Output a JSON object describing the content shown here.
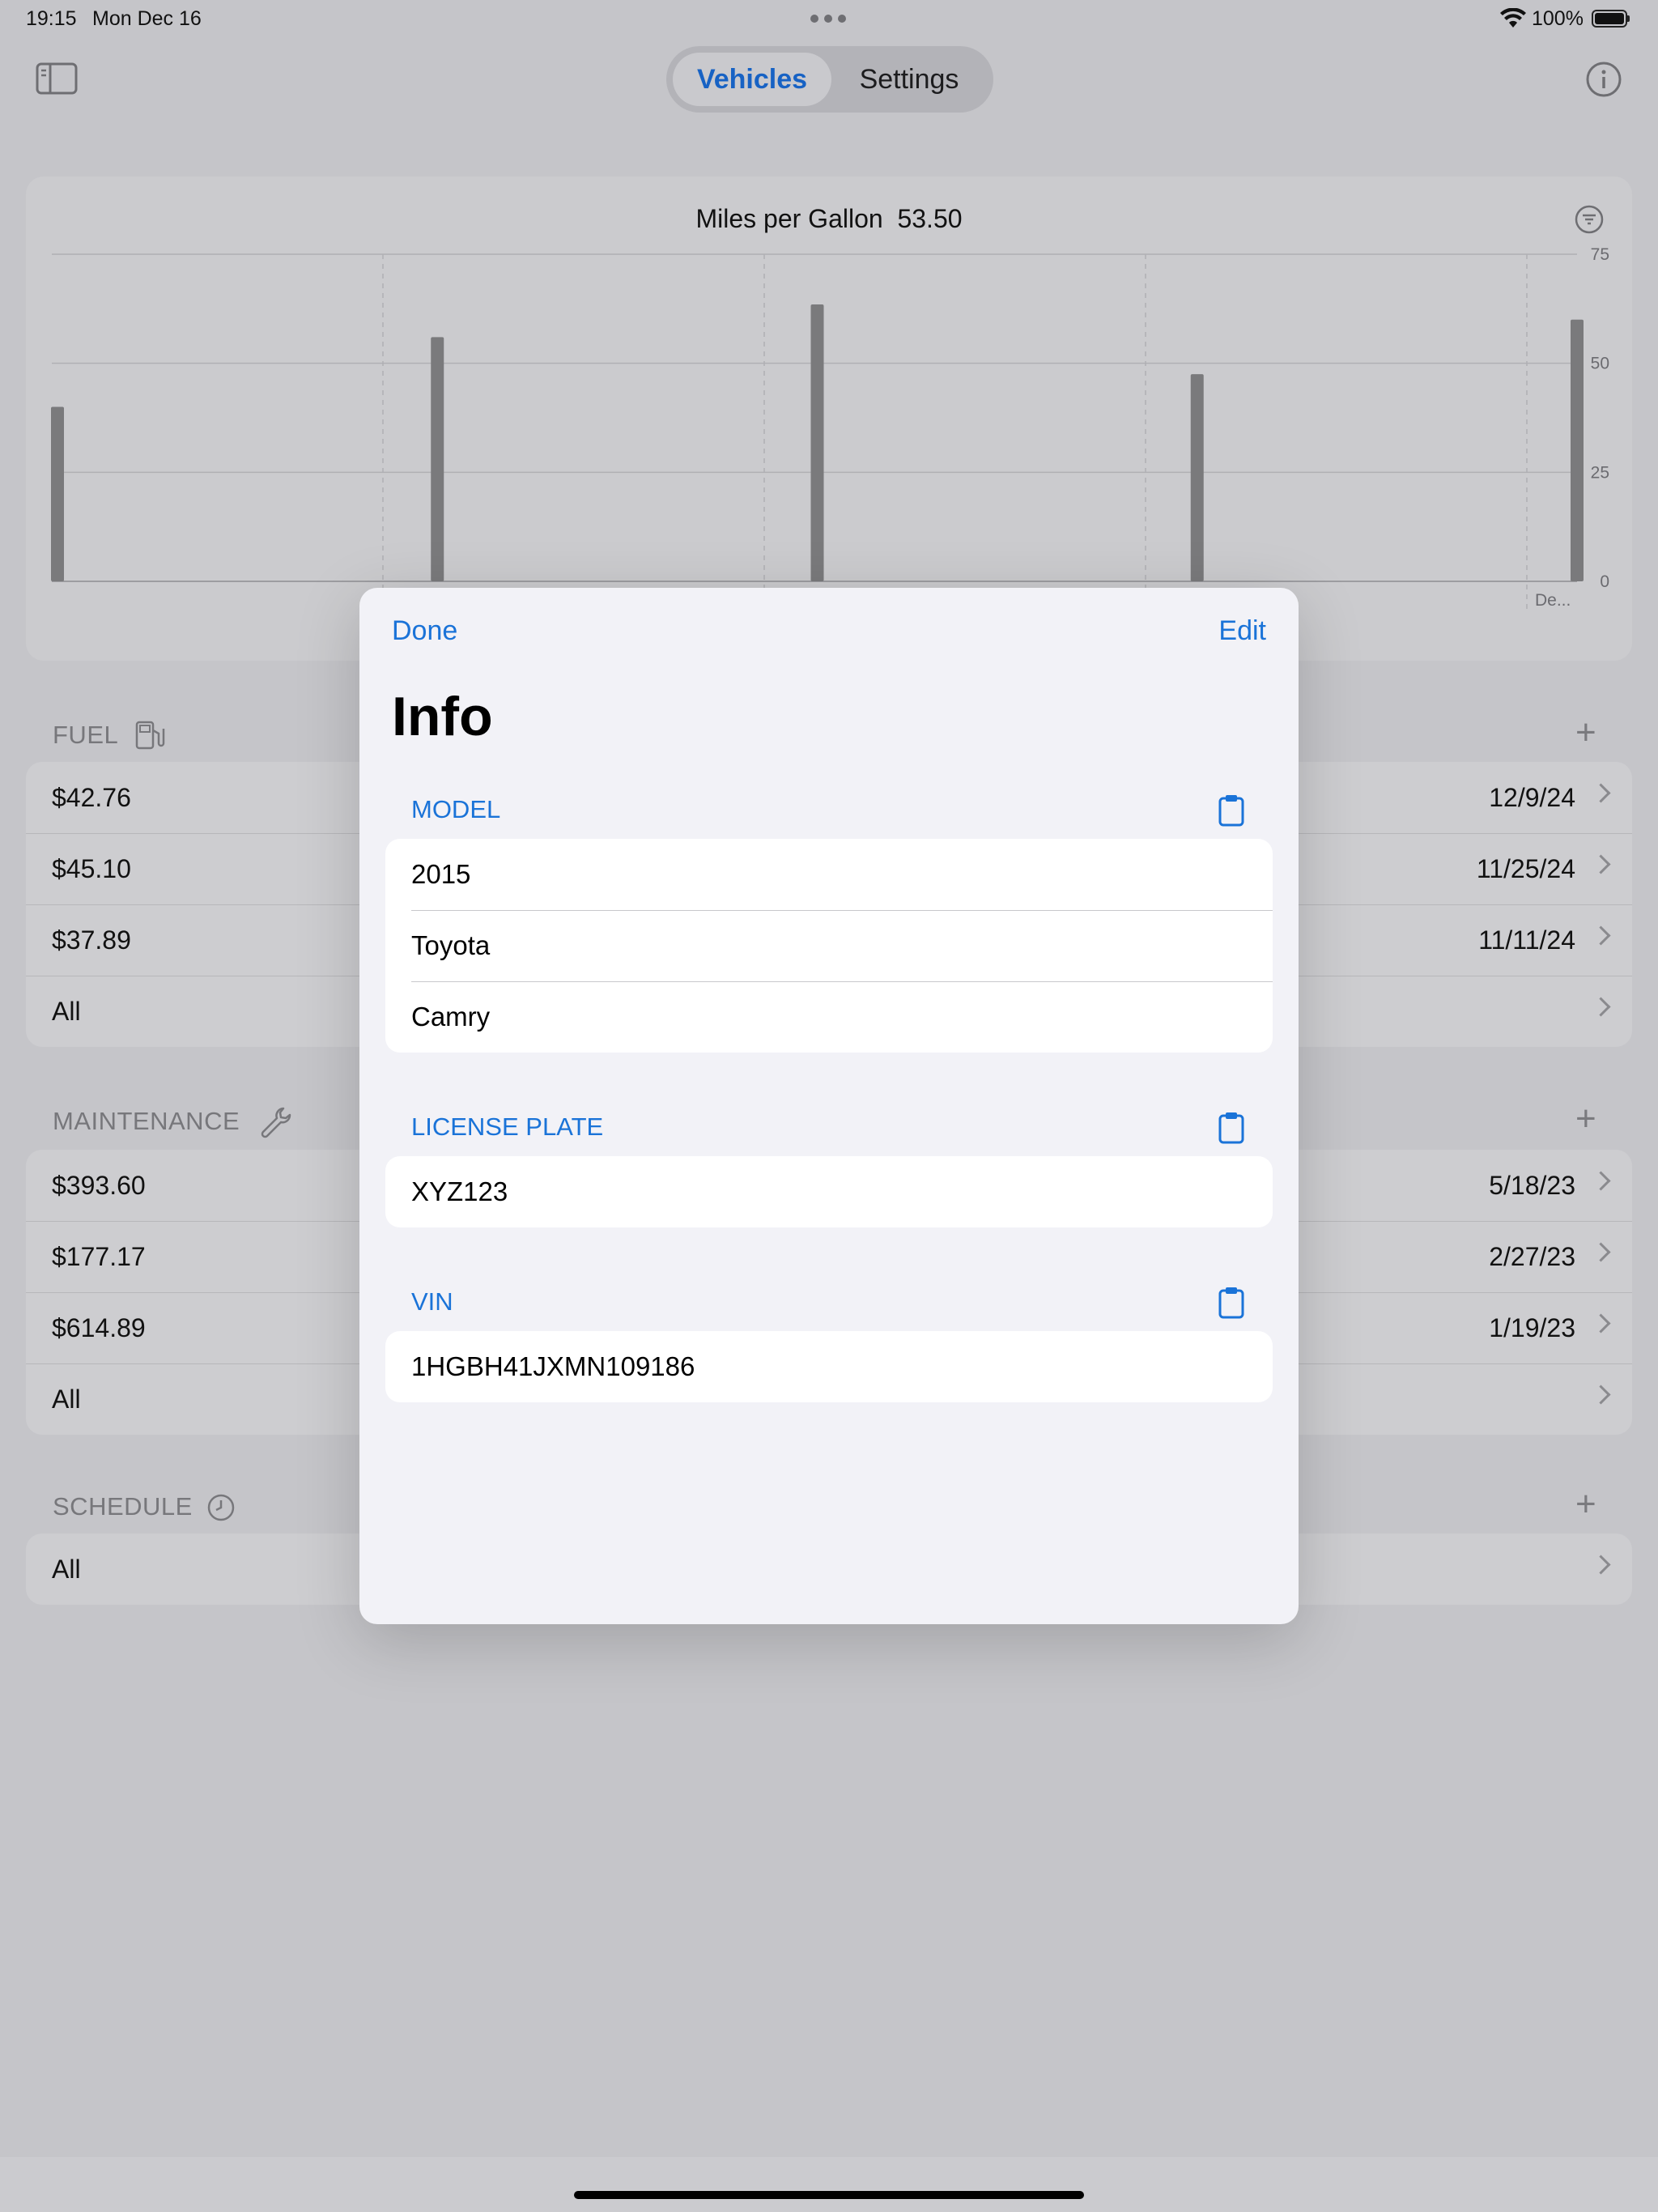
{
  "status_bar": {
    "time": "19:15",
    "date": "Mon Dec 16",
    "battery": "100%"
  },
  "nav": {
    "tabs": [
      {
        "label": "Vehicles",
        "active": true
      },
      {
        "label": "Settings",
        "active": false
      }
    ]
  },
  "chart": {
    "title": "Miles per Gallon",
    "value": "53.50",
    "y_ticks": [
      "75",
      "50",
      "25",
      "0"
    ],
    "x_label": "De..."
  },
  "chart_data": {
    "type": "bar",
    "title": "Miles per Gallon  53.50",
    "ylim": [
      0,
      75
    ],
    "y_ticks": [
      0,
      25,
      50,
      75
    ],
    "x_tick_labels": [
      "De..."
    ],
    "values": [
      40,
      56,
      63.5,
      47.5,
      60
    ],
    "grid": true,
    "bar_color": "#7a7a7c"
  },
  "fuel": {
    "header": "FUEL",
    "rows": [
      {
        "amount": "$42.76",
        "date": "12/9/24"
      },
      {
        "amount": "$45.10",
        "date": "11/25/24"
      },
      {
        "amount": "$37.89",
        "date": "11/11/24"
      }
    ],
    "all_label": "All"
  },
  "maintenance": {
    "header": "MAINTENANCE",
    "rows": [
      {
        "amount": "$393.60",
        "date": "5/18/23"
      },
      {
        "amount": "$177.17",
        "date": "2/27/23"
      },
      {
        "amount": "$614.89",
        "date": "1/19/23"
      }
    ],
    "all_label": "All"
  },
  "schedule": {
    "header": "SCHEDULE",
    "all_label": "All"
  },
  "modal": {
    "done_label": "Done",
    "edit_label": "Edit",
    "title": "Info",
    "model": {
      "header": "MODEL",
      "values": [
        "2015",
        "Toyota",
        "Camry"
      ]
    },
    "license_plate": {
      "header": "LICENSE PLATE",
      "value": "XYZ123"
    },
    "vin": {
      "header": "VIN",
      "value": "1HGBH41JXMN109186"
    }
  },
  "colors": {
    "accent": "#1a73d8",
    "background": "#c5c5c9",
    "modal_bg": "#f2f2f7"
  },
  "icons": [
    "sidebar-icon",
    "info-icon",
    "filter-icon",
    "fuel-pump-icon",
    "wrench-icon",
    "clock-icon",
    "plus-icon",
    "chevron-right-icon",
    "clipboard-icon",
    "wifi-icon",
    "battery-icon",
    "ellipsis-icon"
  ]
}
